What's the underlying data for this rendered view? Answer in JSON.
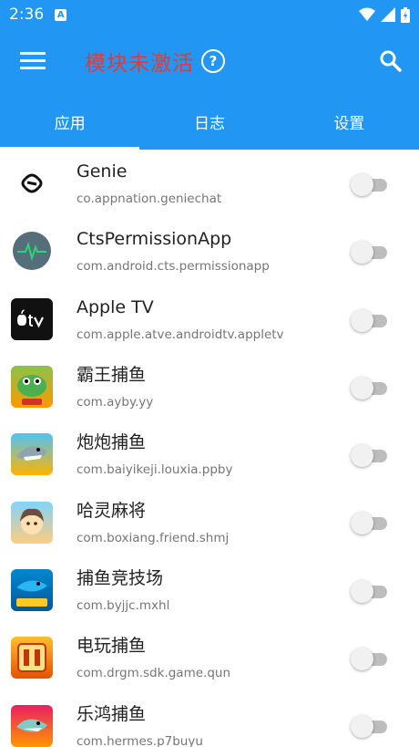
{
  "status": {
    "time": "2:36",
    "badge": "A"
  },
  "toolbar": {
    "title": "模块未激活",
    "help_symbol": "?",
    "title_color": "#e53935",
    "bar_color": "#2196f3"
  },
  "tabs": [
    {
      "label": "应用",
      "selected": true
    },
    {
      "label": "日志",
      "selected": false
    },
    {
      "label": "设置",
      "selected": false
    }
  ],
  "apps": [
    {
      "name": "Genie",
      "package": "co.appnation.geniechat",
      "icon": "genie-logo-icon",
      "enabled": false
    },
    {
      "name": "CtsPermissionApp",
      "package": "com.android.cts.permissionapp",
      "icon": "android-heartbeat-icon",
      "enabled": false
    },
    {
      "name": "Apple TV",
      "package": "com.apple.atve.androidtv.appletv",
      "icon": "apple-tv-icon",
      "enabled": false
    },
    {
      "name": "霸王捕鱼",
      "package": "com.ayby.yy",
      "icon": "fish-game-icon",
      "enabled": false
    },
    {
      "name": "炮炮捕鱼",
      "package": "com.baiyikeji.louxia.ppby",
      "icon": "shark-game-icon",
      "enabled": false
    },
    {
      "name": "哈灵麻将",
      "package": "com.boxiang.friend.shmj",
      "icon": "mahjong-girl-icon",
      "enabled": false
    },
    {
      "name": "捕鱼竞技场",
      "package": "com.byjjc.mxhl",
      "icon": "fish-arena-icon",
      "enabled": false
    },
    {
      "name": "电玩捕鱼",
      "package": "com.drgm.sdk.game.qun",
      "icon": "arcade-fish-icon",
      "enabled": false
    },
    {
      "name": "乐鸿捕鱼",
      "package": "com.hermes.p7buyu",
      "icon": "lehong-fish-icon",
      "enabled": false
    }
  ]
}
